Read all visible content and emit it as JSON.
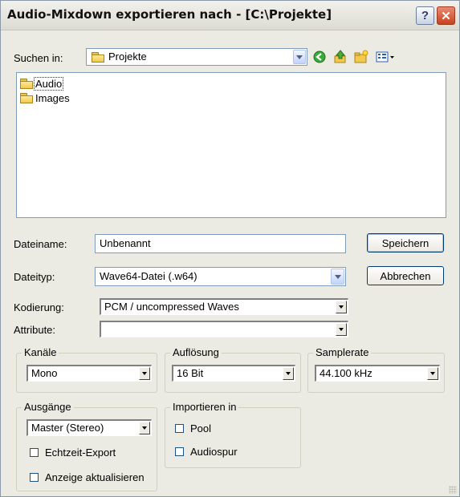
{
  "window": {
    "title": "Audio-Mixdown exportieren nach - [C:\\Projekte]",
    "help_glyph": "?",
    "close_glyph": "✕"
  },
  "lookin": {
    "label": "Suchen in:",
    "value": "Projekte",
    "toolbar_icons": [
      "back-icon",
      "up-folder-icon",
      "new-folder-icon",
      "view-menu-icon"
    ]
  },
  "files": [
    {
      "name": "Audio",
      "icon": "folder-icon"
    },
    {
      "name": "Images",
      "icon": "folder-icon"
    }
  ],
  "filename": {
    "label": "Dateiname:",
    "value": "Unbenannt"
  },
  "filetype": {
    "label": "Dateityp:",
    "value": "Wave64-Datei (.w64)"
  },
  "buttons": {
    "save": "Speichern",
    "cancel": "Abbrechen"
  },
  "encoding": {
    "label": "Kodierung:",
    "value": "PCM / uncompressed Waves"
  },
  "attributes": {
    "label": "Attribute:",
    "value": ""
  },
  "channels": {
    "label": "Kanäle",
    "value": "Mono"
  },
  "resolution": {
    "label": "Auflösung",
    "value": "16 Bit"
  },
  "samplerate": {
    "label": "Samplerate",
    "value": "44.100 kHz"
  },
  "outputs": {
    "label": "Ausgänge",
    "value": "Master (Stereo)",
    "realtime_export": {
      "label": "Echtzeit-Export",
      "checked": false
    },
    "update_display": {
      "label": "Anzeige aktualisieren",
      "checked": false
    }
  },
  "import": {
    "label": "Importieren in",
    "pool": {
      "label": "Pool",
      "checked": false
    },
    "audio_track": {
      "label": "Audiospur",
      "checked": false
    }
  },
  "colors": {
    "window_bg": "#ecebe3",
    "field_border": "#7f9db9",
    "button_border": "#003c74",
    "close_button": "#c9401e"
  }
}
